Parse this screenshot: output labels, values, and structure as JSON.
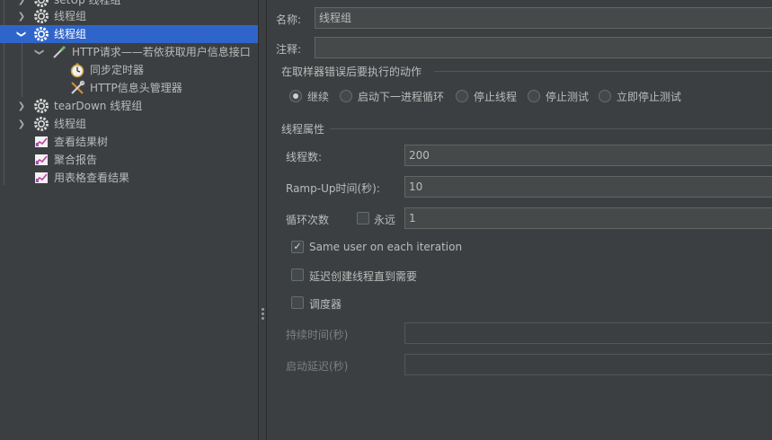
{
  "tree": {
    "items": [
      {
        "label": "setUp 线程组",
        "icon": "gear-icon"
      },
      {
        "label": "线程组",
        "icon": "gear-icon"
      },
      {
        "label": "线程组",
        "icon": "gear-icon"
      },
      {
        "label": "HTTP请求——若依获取用户信息接口",
        "icon": "pipette-icon"
      },
      {
        "label": "同步定时器",
        "icon": "timer-icon"
      },
      {
        "label": "HTTP信息头管理器",
        "icon": "tools-icon"
      },
      {
        "label": "tearDown 线程组",
        "icon": "gear-icon"
      },
      {
        "label": "线程组",
        "icon": "gear-icon"
      },
      {
        "label": "查看结果树",
        "icon": "chart-icon"
      },
      {
        "label": "聚合报告",
        "icon": "chart-icon"
      },
      {
        "label": "用表格查看结果",
        "icon": "chart-icon"
      }
    ]
  },
  "form": {
    "name_label": "名称:",
    "name_value": "线程组",
    "comment_label": "注释:",
    "comment_value": "",
    "error_action_title": "在取样器错误后要执行的动作",
    "error_actions": [
      {
        "label": "继续",
        "selected": true
      },
      {
        "label": "启动下一进程循环",
        "selected": false
      },
      {
        "label": "停止线程",
        "selected": false
      },
      {
        "label": "停止测试",
        "selected": false
      },
      {
        "label": "立即停止测试",
        "selected": false
      }
    ],
    "thread_props_title": "线程属性",
    "threads_label": "线程数:",
    "threads_value": "200",
    "rampup_label": "Ramp-Up时间(秒):",
    "rampup_value": "10",
    "loop_label": "循环次数",
    "forever_label": "永远",
    "forever_checked": false,
    "loop_value": "1",
    "same_user_label": "Same user on each iteration",
    "same_user_checked": true,
    "delay_label": "延迟创建线程直到需要",
    "delay_checked": false,
    "scheduler_label": "调度器",
    "scheduler_checked": false,
    "duration_label": "持续时间(秒)",
    "duration_value": "",
    "startup_delay_label": "启动延迟(秒)",
    "startup_delay_value": ""
  },
  "colors": {
    "background": "#3c3f41",
    "selection": "#2f65ca",
    "field": "#45494a",
    "text": "#bbbbbb"
  }
}
